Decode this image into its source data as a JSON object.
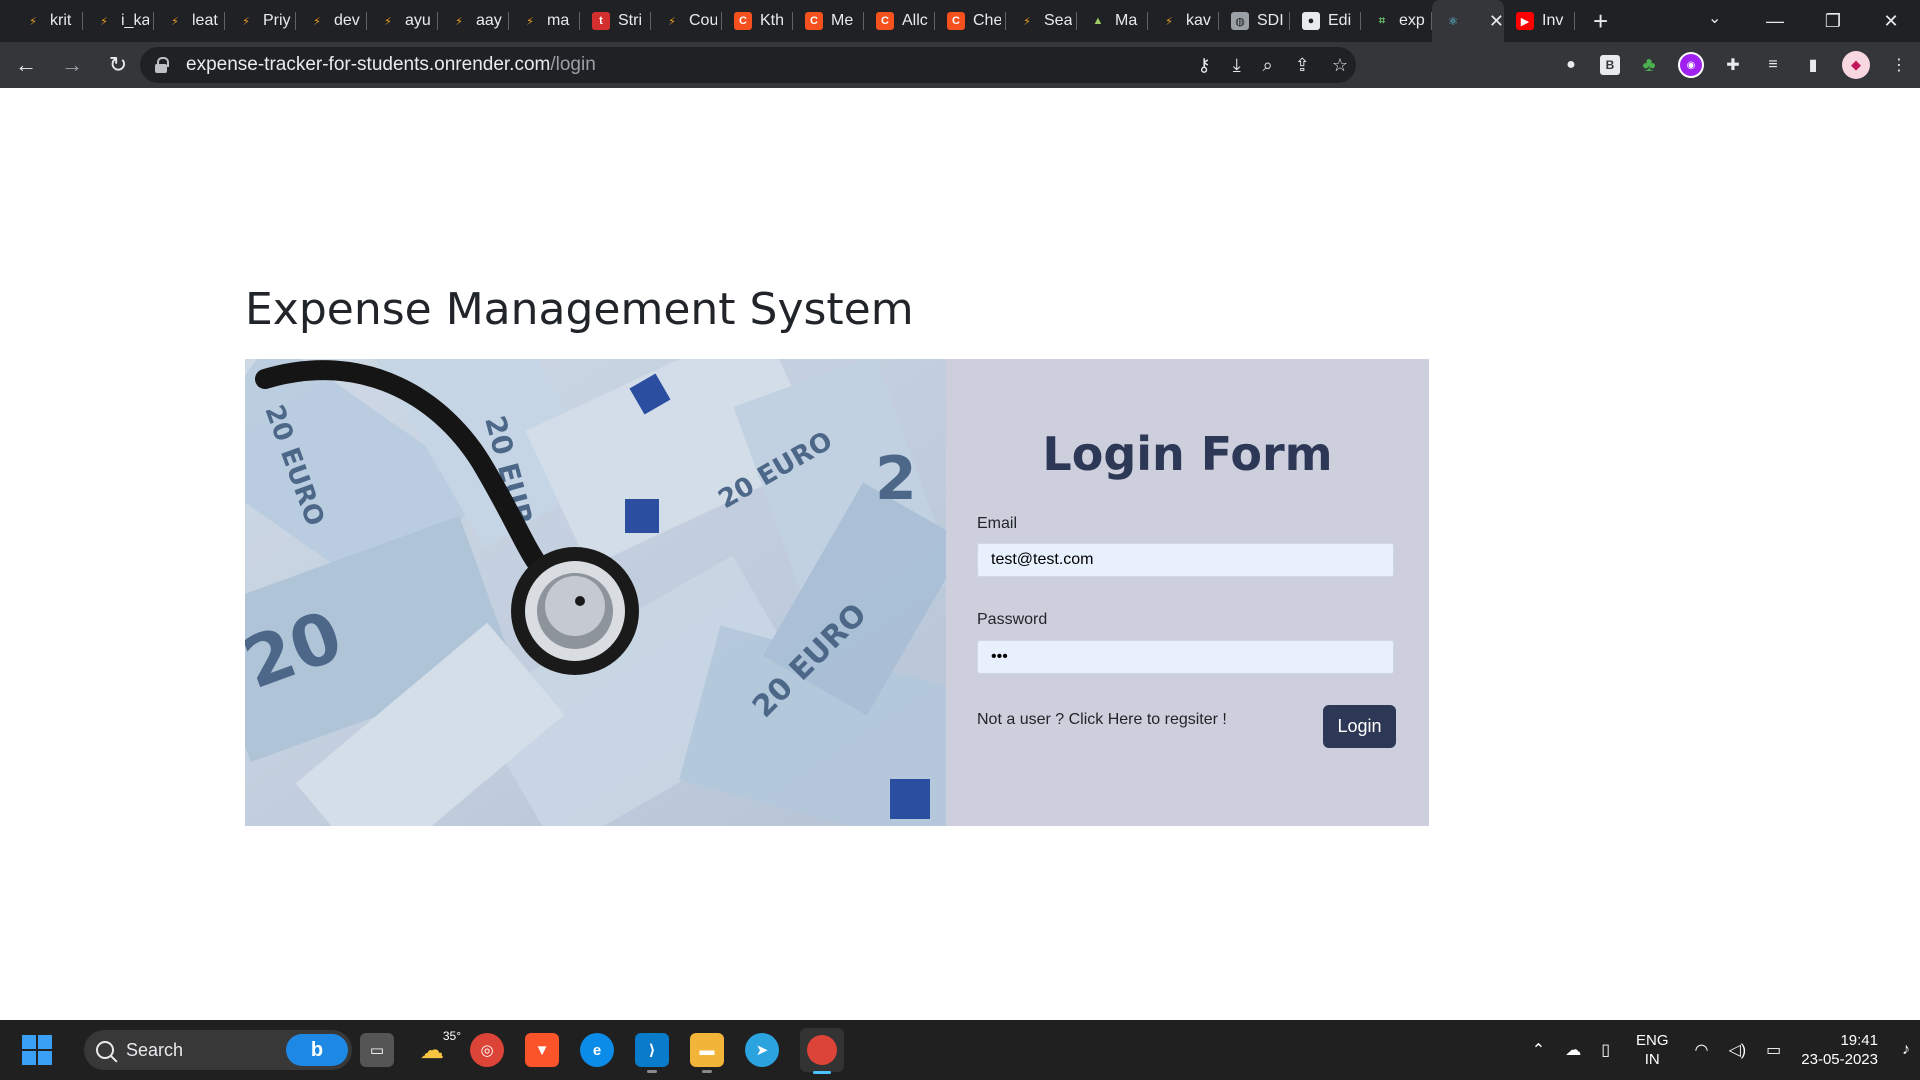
{
  "browser": {
    "tabs": [
      {
        "label": "krit",
        "icon": "lightning-icon"
      },
      {
        "label": "i_ka",
        "icon": "lightning-icon"
      },
      {
        "label": "leat",
        "icon": "lightning-icon"
      },
      {
        "label": "Priy",
        "icon": "lightning-icon"
      },
      {
        "label": "dev",
        "icon": "lightning-icon"
      },
      {
        "label": "ayu",
        "icon": "lightning-icon"
      },
      {
        "label": "aay",
        "icon": "lightning-icon"
      },
      {
        "label": "ma",
        "icon": "lightning-icon"
      },
      {
        "label": "Stri",
        "icon": "tuf-icon"
      },
      {
        "label": "Cou",
        "icon": "lightning-icon"
      },
      {
        "label": "Kth",
        "icon": "cc-icon"
      },
      {
        "label": "Me",
        "icon": "cc-icon"
      },
      {
        "label": "Allc",
        "icon": "cc-icon"
      },
      {
        "label": "Che",
        "icon": "cc-icon"
      },
      {
        "label": "Sea",
        "icon": "lightning-icon"
      },
      {
        "label": "Ma",
        "icon": "mountain-icon"
      },
      {
        "label": "kav",
        "icon": "lightning-icon"
      },
      {
        "label": "SDI",
        "icon": "globe-icon"
      },
      {
        "label": "Edi",
        "icon": "github-icon"
      },
      {
        "label": "exp",
        "icon": "bracket-icon"
      },
      {
        "label": "",
        "icon": "react-icon",
        "active": true
      },
      {
        "label": "Inv",
        "icon": "youtube-icon"
      }
    ],
    "url_host": "expense-tracker-for-students.onrender.com",
    "url_path": "/login"
  },
  "page": {
    "title": "Expense Management System",
    "hero_image": "euro-banknotes-with-stethoscope-image"
  },
  "form": {
    "title": "Login Form",
    "email_label": "Email",
    "email_value": "test@test.com",
    "password_label": "Password",
    "password_value": "•••",
    "register_text": "Not a user ? Click Here to regsiter !",
    "login_button": "Login"
  },
  "taskbar": {
    "search_placeholder": "Search",
    "weather_temp": "35°",
    "lang_line1": "ENG",
    "lang_line2": "IN",
    "time": "19:41",
    "date": "23-05-2023"
  },
  "colors": {
    "form_bg": "#cdd0dc",
    "accent": "#2d3756",
    "input_bg": "#e8f0fe"
  }
}
